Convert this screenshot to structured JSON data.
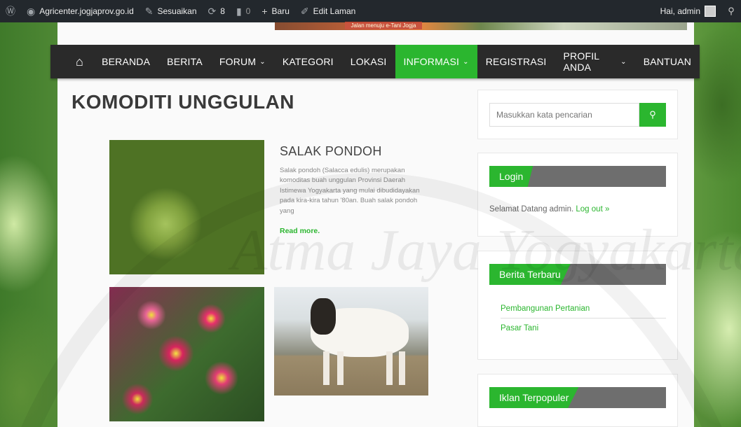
{
  "admin_bar": {
    "site_name": "Agricenter.jogjaprov.go.id",
    "customize": "Sesuaikan",
    "updates_count": "8",
    "comments_count": "0",
    "new_label": "Baru",
    "edit_label": "Edit Laman",
    "greeting": "Hai, admin"
  },
  "banner": {
    "tag_text": "Jalan menuju e-Tani Jogja"
  },
  "nav": {
    "items": [
      "BERANDA",
      "BERITA",
      "FORUM",
      "KATEGORI",
      "LOKASI",
      "INFORMASI",
      "REGISTRASI",
      "PROFIL ANDA",
      "BANTUAN"
    ],
    "active": "INFORMASI"
  },
  "main": {
    "page_title": "KOMODITI UNGGULAN",
    "post": {
      "title": "SALAK PONDOH",
      "excerpt": "Salak pondoh (Salacca edulis) merupakan komoditas buah unggulan Provinsi Daerah Istimewa Yogyakarta yang mulai dibudidayakan pada kira-kira tahun '80an. Buah salak pondoh yang",
      "read_more": "Read more."
    }
  },
  "sidebar": {
    "search_placeholder": "Masukkan kata pencarian",
    "login": {
      "heading": "Login",
      "welcome": "Selamat Datang admin.",
      "logout": "Log out »"
    },
    "berita_terbaru": {
      "heading": "Berita Terbaru",
      "links": [
        "Pembangunan Pertanian",
        "Pasar Tani"
      ]
    },
    "iklan_terpopuler": {
      "heading": "Iklan Terpopuler"
    }
  },
  "watermark": "Atma Jaya Yogyakarta",
  "colors": {
    "accent": "#2bb62f",
    "navbar": "#2a2a2a",
    "admin_bar": "#23282d"
  }
}
